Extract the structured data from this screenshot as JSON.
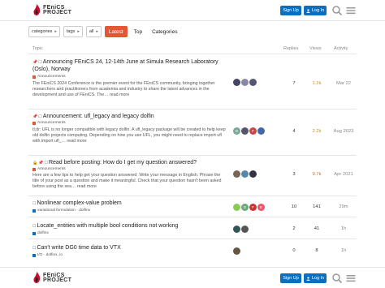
{
  "header": {
    "logo_text_line1": "FEniCS",
    "logo_text_line2": "PROJECT",
    "signup_label": "Sign Up",
    "login_label": "Log In",
    "login_icon": "person-icon",
    "search_icon": "search-icon",
    "menu_icon": "hamburger-menu-icon"
  },
  "nav": {
    "categories_label": "categories",
    "tags_label": "tags",
    "all_label": "all",
    "latest_label": "Latest",
    "top_label": "Top",
    "categories_link": "Categories"
  },
  "table": {
    "col_topic": "Topic",
    "col_replies": "Replies",
    "col_views": "Views",
    "col_activity": "Activity"
  },
  "topics": [
    {
      "title": "Announcing FEniCS 24, 12-14th June at Simula Research Laboratory (Oslo), Norway",
      "category": "Announcements",
      "category_color": "#e45735",
      "excerpt": "The FEniCS 2024 Conference is the premier event for the FEniCS community, bringing together researchers and practitioners from academia and industry to share the latest advances in the development and use of FEniCS. The… read more",
      "replies": "7",
      "views": "1.2k",
      "activity": "Mar 22"
    },
    {
      "title": "Announcement: ufl_legacy and legacy dolfin",
      "category": "Announcements",
      "category_color": "#e45735",
      "excerpt": "tl;dr: UFL is no longer compatible with legacy dolfin. A ufl_legacy package will be created to help keep old dolfin projects computing. Depending on how you use UFL, you might need to replace import ufl with import ufl_… read more",
      "replies": "4",
      "views": "2.2k",
      "activity": "Aug 2023"
    },
    {
      "title": "Read before posting: How do I get my question answered?",
      "category": "Announcements",
      "category_color": "#e45735",
      "excerpt": "Here are a few tips to help get your question answered: Write your message in English. Phrase the title of your post as a question and make it meaningful. Check that your question hasn't been asked before using the sea… read more",
      "replies": "3",
      "views": "9.7k",
      "activity": "Apr 2021"
    },
    {
      "title": "Nonlinear complex-value problem",
      "category": "variational formulation · dolfinx",
      "category_color": "#0c6fbe",
      "replies": "10",
      "views": "141",
      "activity": "29m"
    },
    {
      "title": "Locate_entities with multiple bool conditions not working",
      "category": "dolfinx",
      "category_color": "#0c6fbe",
      "replies": "2",
      "views": "41",
      "activity": "1h"
    },
    {
      "title": "Can't write DG0 time data to VTX",
      "category": "I/O · dolfinx, io",
      "category_color": "#0c6fbe",
      "replies": "0",
      "views": "8",
      "activity": "1h"
    }
  ],
  "colors": {
    "primary": "#0c6fbe",
    "accent": "#e45735"
  }
}
